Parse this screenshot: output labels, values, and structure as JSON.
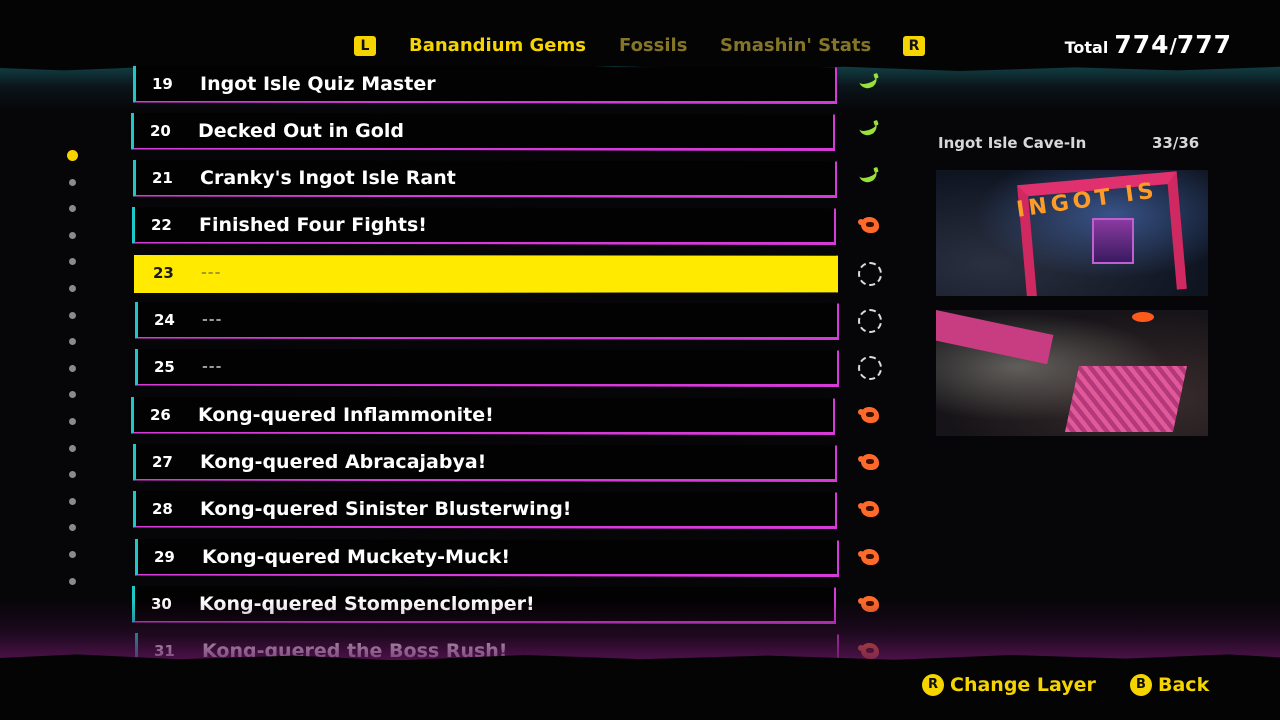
{
  "header": {
    "left_key": "L",
    "right_key": "R",
    "tabs": [
      {
        "label": "Banandium Gems",
        "active": true
      },
      {
        "label": "Fossils",
        "active": false
      },
      {
        "label": "Smashin' Stats",
        "active": false
      }
    ],
    "total_label": "Total",
    "total_value": "774",
    "total_max": "777",
    "total_sep": "/"
  },
  "list": {
    "selected_number": "23",
    "rows": [
      {
        "number": "19",
        "title": "Ingot Isle Quiz Master",
        "status": "banana"
      },
      {
        "number": "20",
        "title": "Decked Out in Gold",
        "status": "banana"
      },
      {
        "number": "21",
        "title": "Cranky's Ingot Isle Rant",
        "status": "banana"
      },
      {
        "number": "22",
        "title": "Finished Four Fights!",
        "status": "kong"
      },
      {
        "number": "23",
        "title": "---",
        "status": "empty"
      },
      {
        "number": "24",
        "title": "---",
        "status": "empty"
      },
      {
        "number": "25",
        "title": "---",
        "status": "empty"
      },
      {
        "number": "26",
        "title": "Kong-quered Inflammonite!",
        "status": "kong"
      },
      {
        "number": "27",
        "title": "Kong-quered Abracajabya!",
        "status": "kong"
      },
      {
        "number": "28",
        "title": "Kong-quered Sinister Blusterwing!",
        "status": "kong"
      },
      {
        "number": "29",
        "title": "Kong-quered Muckety-Muck!",
        "status": "kong"
      },
      {
        "number": "30",
        "title": "Kong-quered Stompenclomper!",
        "status": "kong"
      },
      {
        "number": "31",
        "title": "Kong-quered the Boss Rush!",
        "status": "kong"
      }
    ]
  },
  "scrollbar": {
    "dot_count": 17,
    "active_index": 0
  },
  "panel": {
    "title": "Ingot Isle Cave-In",
    "count": "33/36",
    "sign_text": "INGOT IS"
  },
  "footer": {
    "change_layer_key": "R",
    "change_layer_label": "Change Layer",
    "back_key": "B",
    "back_label": "Back"
  },
  "colors": {
    "accent_yellow": "#f5d400",
    "selected_row": "#ffea00",
    "row_border_teal": "#1fc8c8",
    "row_border_magenta": "#d63ad8",
    "banana_green": "#9ae03a",
    "kong_orange": "#ff6a2a"
  }
}
